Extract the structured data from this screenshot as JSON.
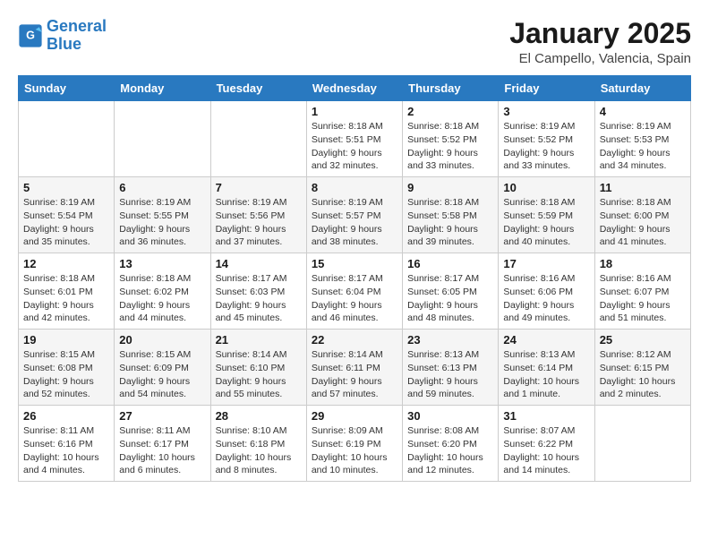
{
  "logo": {
    "line1": "General",
    "line2": "Blue"
  },
  "title": "January 2025",
  "location": "El Campello, Valencia, Spain",
  "days_of_week": [
    "Sunday",
    "Monday",
    "Tuesday",
    "Wednesday",
    "Thursday",
    "Friday",
    "Saturday"
  ],
  "weeks": [
    [
      {
        "day": "",
        "info": ""
      },
      {
        "day": "",
        "info": ""
      },
      {
        "day": "",
        "info": ""
      },
      {
        "day": "1",
        "info": "Sunrise: 8:18 AM\nSunset: 5:51 PM\nDaylight: 9 hours and 32 minutes."
      },
      {
        "day": "2",
        "info": "Sunrise: 8:18 AM\nSunset: 5:52 PM\nDaylight: 9 hours and 33 minutes."
      },
      {
        "day": "3",
        "info": "Sunrise: 8:19 AM\nSunset: 5:52 PM\nDaylight: 9 hours and 33 minutes."
      },
      {
        "day": "4",
        "info": "Sunrise: 8:19 AM\nSunset: 5:53 PM\nDaylight: 9 hours and 34 minutes."
      }
    ],
    [
      {
        "day": "5",
        "info": "Sunrise: 8:19 AM\nSunset: 5:54 PM\nDaylight: 9 hours and 35 minutes."
      },
      {
        "day": "6",
        "info": "Sunrise: 8:19 AM\nSunset: 5:55 PM\nDaylight: 9 hours and 36 minutes."
      },
      {
        "day": "7",
        "info": "Sunrise: 8:19 AM\nSunset: 5:56 PM\nDaylight: 9 hours and 37 minutes."
      },
      {
        "day": "8",
        "info": "Sunrise: 8:19 AM\nSunset: 5:57 PM\nDaylight: 9 hours and 38 minutes."
      },
      {
        "day": "9",
        "info": "Sunrise: 8:18 AM\nSunset: 5:58 PM\nDaylight: 9 hours and 39 minutes."
      },
      {
        "day": "10",
        "info": "Sunrise: 8:18 AM\nSunset: 5:59 PM\nDaylight: 9 hours and 40 minutes."
      },
      {
        "day": "11",
        "info": "Sunrise: 8:18 AM\nSunset: 6:00 PM\nDaylight: 9 hours and 41 minutes."
      }
    ],
    [
      {
        "day": "12",
        "info": "Sunrise: 8:18 AM\nSunset: 6:01 PM\nDaylight: 9 hours and 42 minutes."
      },
      {
        "day": "13",
        "info": "Sunrise: 8:18 AM\nSunset: 6:02 PM\nDaylight: 9 hours and 44 minutes."
      },
      {
        "day": "14",
        "info": "Sunrise: 8:17 AM\nSunset: 6:03 PM\nDaylight: 9 hours and 45 minutes."
      },
      {
        "day": "15",
        "info": "Sunrise: 8:17 AM\nSunset: 6:04 PM\nDaylight: 9 hours and 46 minutes."
      },
      {
        "day": "16",
        "info": "Sunrise: 8:17 AM\nSunset: 6:05 PM\nDaylight: 9 hours and 48 minutes."
      },
      {
        "day": "17",
        "info": "Sunrise: 8:16 AM\nSunset: 6:06 PM\nDaylight: 9 hours and 49 minutes."
      },
      {
        "day": "18",
        "info": "Sunrise: 8:16 AM\nSunset: 6:07 PM\nDaylight: 9 hours and 51 minutes."
      }
    ],
    [
      {
        "day": "19",
        "info": "Sunrise: 8:15 AM\nSunset: 6:08 PM\nDaylight: 9 hours and 52 minutes."
      },
      {
        "day": "20",
        "info": "Sunrise: 8:15 AM\nSunset: 6:09 PM\nDaylight: 9 hours and 54 minutes."
      },
      {
        "day": "21",
        "info": "Sunrise: 8:14 AM\nSunset: 6:10 PM\nDaylight: 9 hours and 55 minutes."
      },
      {
        "day": "22",
        "info": "Sunrise: 8:14 AM\nSunset: 6:11 PM\nDaylight: 9 hours and 57 minutes."
      },
      {
        "day": "23",
        "info": "Sunrise: 8:13 AM\nSunset: 6:13 PM\nDaylight: 9 hours and 59 minutes."
      },
      {
        "day": "24",
        "info": "Sunrise: 8:13 AM\nSunset: 6:14 PM\nDaylight: 10 hours and 1 minute."
      },
      {
        "day": "25",
        "info": "Sunrise: 8:12 AM\nSunset: 6:15 PM\nDaylight: 10 hours and 2 minutes."
      }
    ],
    [
      {
        "day": "26",
        "info": "Sunrise: 8:11 AM\nSunset: 6:16 PM\nDaylight: 10 hours and 4 minutes."
      },
      {
        "day": "27",
        "info": "Sunrise: 8:11 AM\nSunset: 6:17 PM\nDaylight: 10 hours and 6 minutes."
      },
      {
        "day": "28",
        "info": "Sunrise: 8:10 AM\nSunset: 6:18 PM\nDaylight: 10 hours and 8 minutes."
      },
      {
        "day": "29",
        "info": "Sunrise: 8:09 AM\nSunset: 6:19 PM\nDaylight: 10 hours and 10 minutes."
      },
      {
        "day": "30",
        "info": "Sunrise: 8:08 AM\nSunset: 6:20 PM\nDaylight: 10 hours and 12 minutes."
      },
      {
        "day": "31",
        "info": "Sunrise: 8:07 AM\nSunset: 6:22 PM\nDaylight: 10 hours and 14 minutes."
      },
      {
        "day": "",
        "info": ""
      }
    ]
  ]
}
